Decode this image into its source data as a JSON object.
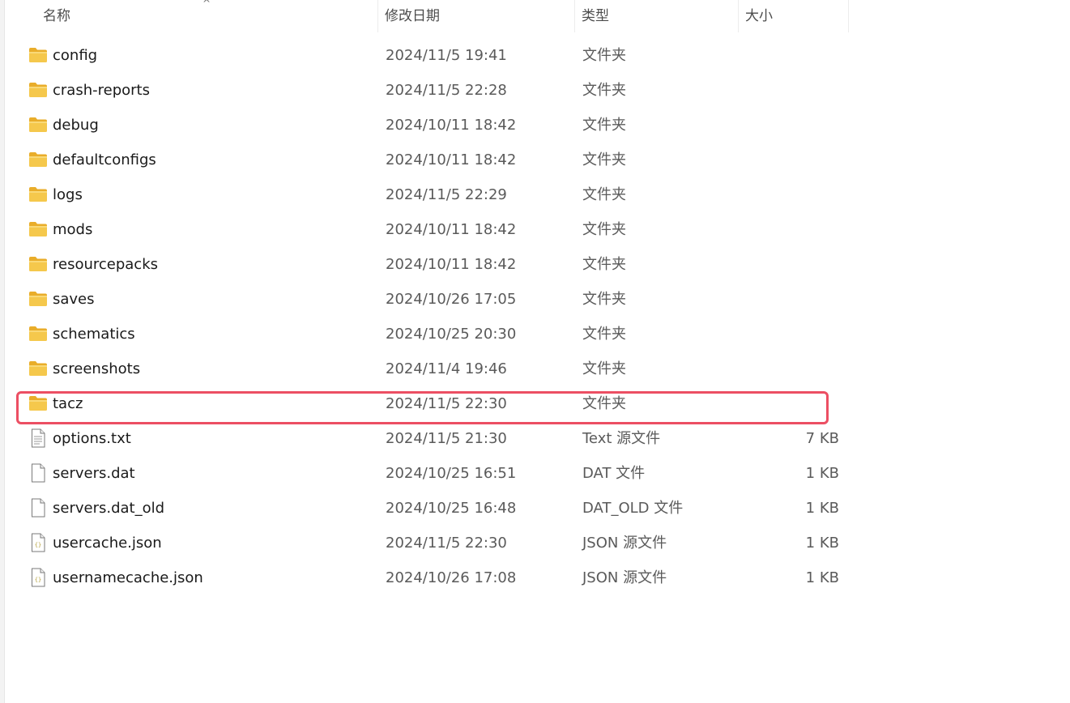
{
  "columns": {
    "name": "名称",
    "date": "修改日期",
    "type": "类型",
    "size": "大小",
    "sort_indicator": "^"
  },
  "icons": {
    "folder": "folder-icon",
    "file": "document-icon",
    "json": "json-file-icon"
  },
  "colors": {
    "folder": "#f5c84c",
    "folder_tab": "#e9ad2a",
    "highlight": "#ec4f63",
    "json_accent": "#b5a03a"
  },
  "files": [
    {
      "icon": "folder",
      "name": "config",
      "date": "2024/11/5 19:41",
      "type": "文件夹",
      "size": ""
    },
    {
      "icon": "folder",
      "name": "crash-reports",
      "date": "2024/11/5 22:28",
      "type": "文件夹",
      "size": ""
    },
    {
      "icon": "folder",
      "name": "debug",
      "date": "2024/10/11 18:42",
      "type": "文件夹",
      "size": ""
    },
    {
      "icon": "folder",
      "name": "defaultconfigs",
      "date": "2024/10/11 18:42",
      "type": "文件夹",
      "size": ""
    },
    {
      "icon": "folder",
      "name": "logs",
      "date": "2024/11/5 22:29",
      "type": "文件夹",
      "size": ""
    },
    {
      "icon": "folder",
      "name": "mods",
      "date": "2024/10/11 18:42",
      "type": "文件夹",
      "size": ""
    },
    {
      "icon": "folder",
      "name": "resourcepacks",
      "date": "2024/10/11 18:42",
      "type": "文件夹",
      "size": ""
    },
    {
      "icon": "folder",
      "name": "saves",
      "date": "2024/10/26 17:05",
      "type": "文件夹",
      "size": ""
    },
    {
      "icon": "folder",
      "name": "schematics",
      "date": "2024/10/25 20:30",
      "type": "文件夹",
      "size": ""
    },
    {
      "icon": "folder",
      "name": "screenshots",
      "date": "2024/11/4 19:46",
      "type": "文件夹",
      "size": ""
    },
    {
      "icon": "folder",
      "name": "tacz",
      "date": "2024/11/5 22:30",
      "type": "文件夹",
      "size": "",
      "highlighted": true
    },
    {
      "icon": "file",
      "name": "options.txt",
      "date": "2024/11/5 21:30",
      "type": "Text 源文件",
      "size": "7 KB"
    },
    {
      "icon": "file",
      "name": "servers.dat",
      "date": "2024/10/25 16:51",
      "type": "DAT 文件",
      "size": "1 KB"
    },
    {
      "icon": "file",
      "name": "servers.dat_old",
      "date": "2024/10/25 16:48",
      "type": "DAT_OLD 文件",
      "size": "1 KB"
    },
    {
      "icon": "json",
      "name": "usercache.json",
      "date": "2024/11/5 22:30",
      "type": "JSON 源文件",
      "size": "1 KB"
    },
    {
      "icon": "json",
      "name": "usernamecache.json",
      "date": "2024/10/26 17:08",
      "type": "JSON 源文件",
      "size": "1 KB"
    }
  ]
}
